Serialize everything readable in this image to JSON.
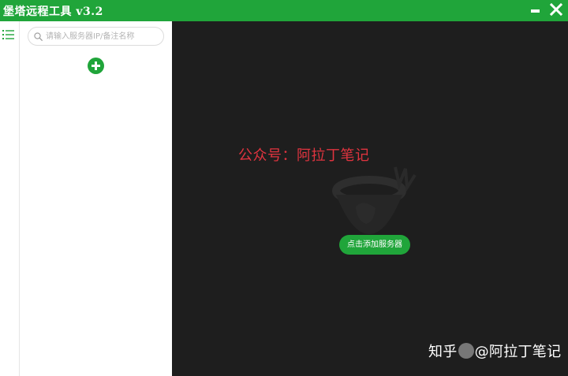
{
  "window": {
    "title": "堡塔远程工具  v3.2"
  },
  "sidebar": {
    "search": {
      "placeholder": "请输入服务器IP/备注名称",
      "value": ""
    }
  },
  "main": {
    "watermark": "公众号：阿拉丁笔记",
    "add_server_label": "点击添加服务器"
  },
  "overlay": {
    "site_watermark": "知乎",
    "author_watermark": "@阿拉丁笔记"
  },
  "colors": {
    "accent": "#20a53a",
    "main_bg": "#1e1e1e",
    "watermark_red": "#e0343f"
  },
  "icons": [
    "menu-icon",
    "search-icon",
    "add-icon",
    "minimize-icon",
    "close-icon"
  ]
}
